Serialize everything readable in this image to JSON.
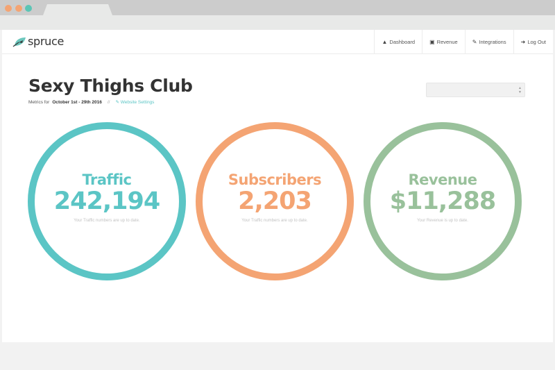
{
  "browser": {
    "window_dots": [
      {
        "name": "close",
        "color": "#f4a473"
      },
      {
        "name": "minimize",
        "color": "#f4a473"
      },
      {
        "name": "maximize",
        "color": "#5bc5b5"
      }
    ]
  },
  "nav": {
    "logo_text": "spruce",
    "items": [
      {
        "label": "Dashboard",
        "icon": "tree-icon",
        "glyph": "▲"
      },
      {
        "label": "Revenue",
        "icon": "money-icon",
        "glyph": "▣"
      },
      {
        "label": "Integrations",
        "icon": "plug-icon",
        "glyph": "✎"
      },
      {
        "label": "Log Out",
        "icon": "sign-out-icon",
        "glyph": "➜"
      }
    ]
  },
  "header": {
    "title": "Sexy Thighs Club",
    "metrics_prefix": "Metrics for",
    "date_range": "October 1st - 29th 2016",
    "separator": "//",
    "settings_link": "Website Settings",
    "select_value": ""
  },
  "metrics": [
    {
      "label": "Traffic",
      "value": "242,194",
      "note": "Your Traffic numbers are up to date.",
      "color": "#5bc5c5"
    },
    {
      "label": "Subscribers",
      "value": "2,203",
      "note": "Your Traffic numbers are up to date.",
      "color": "#f4a473"
    },
    {
      "label": "Revenue",
      "value": "$11,288",
      "note": "Your Revenue is up to date.",
      "color": "#99c19b"
    }
  ]
}
